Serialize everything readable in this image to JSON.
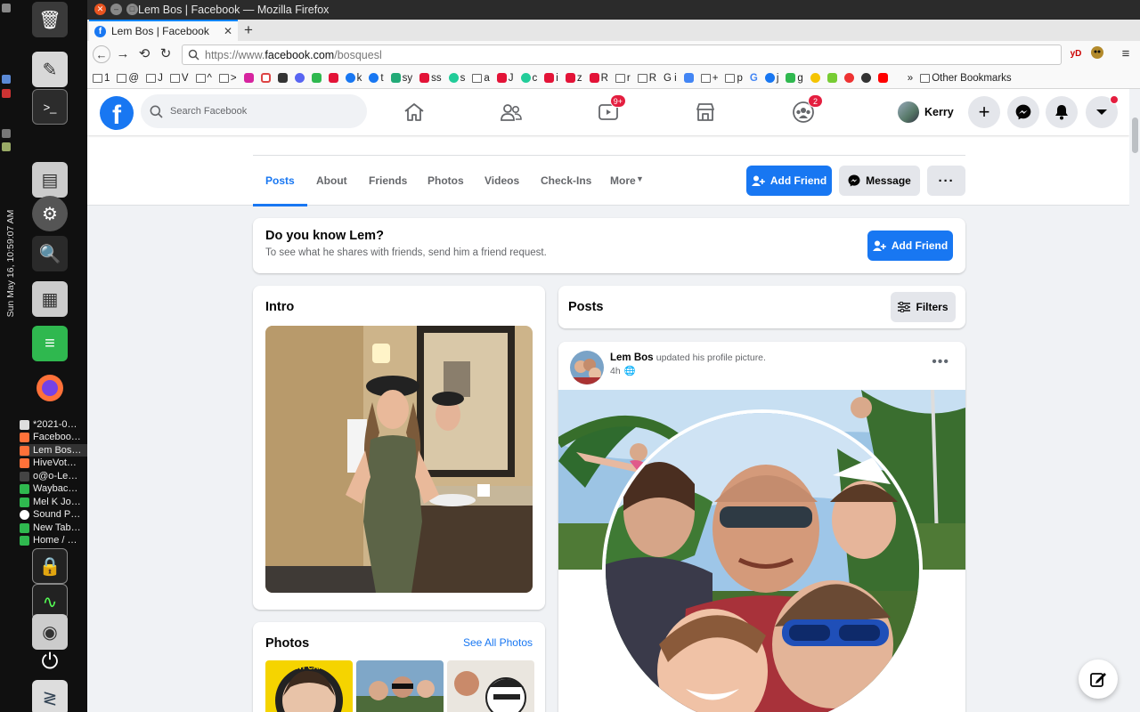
{
  "window": {
    "title": "Lem Bos | Facebook — Mozilla Firefox"
  },
  "dock": {
    "clock": "Sun May 16, 10:59:07 AM",
    "tasks": [
      "*2021-0…",
      "Faceboo…",
      "Lem Bos…",
      "HiveVot…",
      "o@o-Le…",
      "Waybac…",
      "Mel K Jo…",
      "Sound P…",
      "New Tab…",
      "Home / …"
    ]
  },
  "browser": {
    "tab_title": "Lem Bos | Facebook",
    "url_prefix": "https://www.",
    "url_domain": "facebook.com",
    "url_path": "/bosquesl",
    "ext_label": "yD",
    "bookmarks": [
      "1",
      "@",
      "J",
      "V",
      "^",
      ">",
      "k",
      "t",
      "sy",
      "ss",
      "s",
      "a",
      "J",
      "c",
      "i",
      "z",
      "R",
      "r",
      "R",
      "G i",
      "+",
      "p",
      "G",
      "j",
      "g"
    ],
    "other_bookmarks": "Other Bookmarks"
  },
  "fb": {
    "search_placeholder": "Search Facebook",
    "watch_badge": "9+",
    "groups_badge": "2",
    "user_name": "Kerry",
    "profile_tabs": [
      "Posts",
      "About",
      "Friends",
      "Photos",
      "Videos",
      "Check-Ins",
      "More"
    ],
    "add_friend": "Add Friend",
    "message": "Message",
    "know_title": "Do you know Lem?",
    "know_sub": "To see what he shares with friends, send him a friend request.",
    "intro": "Intro",
    "photos": "Photos",
    "see_all_photos": "See All Photos",
    "posts": "Posts",
    "filters": "Filters",
    "post_author": "Lem Bos",
    "post_action": "updated his profile picture.",
    "post_time": "4h",
    "thumb_text": "I DONT CARE IF"
  },
  "colors": {
    "fb_blue": "#1877f2",
    "badge_red": "#e41e3f",
    "page_bg": "#f0f2f5"
  }
}
